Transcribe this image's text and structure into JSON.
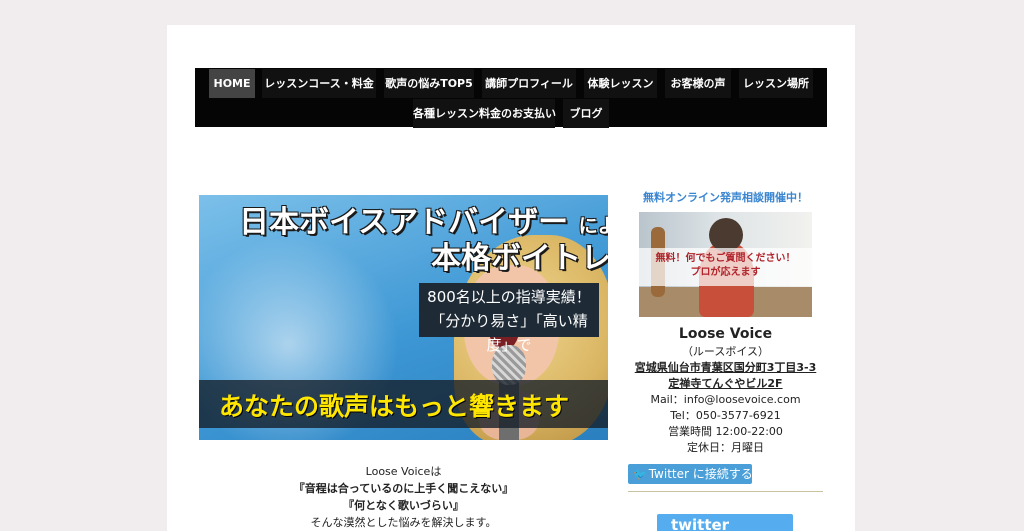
{
  "nav": {
    "items": [
      {
        "label": "HOME",
        "active": true
      },
      {
        "label": "レッスンコース・料金"
      },
      {
        "label": "歌声の悩みTOP5"
      },
      {
        "label": "講師プロフィール"
      },
      {
        "label": "体験レッスン"
      },
      {
        "label": "お客様の声"
      },
      {
        "label": "レッスン場所"
      },
      {
        "label": "各種レッスン料金のお支払い"
      },
      {
        "label": "ブログ"
      }
    ]
  },
  "hero": {
    "line1_main": "日本ボイスアドバイザー",
    "line1_small": "による",
    "line2": "本格ボイトレ",
    "box_line1": "800名以上の指導実績！",
    "box_line2": "「分かり易さ」「高い精度」で",
    "band": "あなたの歌声はもっと響きます"
  },
  "intro": {
    "line1": "Loose Voiceは",
    "line2": "『音程は合っているのに上手く聞こえない』",
    "line3": "『何となく歌いづらい』",
    "line4": "そんな漠然とした悩みを解決します。"
  },
  "sidebar": {
    "title": "無料オンライン発声相談開催中！",
    "image_line1": "無料！何でもご質問ください！",
    "image_line2": "プロが応えます",
    "name": "Loose Voice",
    "kana": "（ルースボイス）",
    "address1": "宮城県仙台市青葉区国分町3丁目3-3",
    "address2": "定禅寺てんぐやビル2F",
    "mail": "Mail：info@loosevoice.com",
    "tel": "Tel：050-3577-6921",
    "hours": "営業時間 12:00-22:00",
    "closed": "定休日：月曜日",
    "twitter_button": "Twitter に接続する",
    "twitter_logo": "twitter"
  },
  "colors": {
    "background": "#f1eced",
    "nav": "#050505",
    "accent_blue": "#3a86d1",
    "twitter": "#4a9fd8"
  }
}
